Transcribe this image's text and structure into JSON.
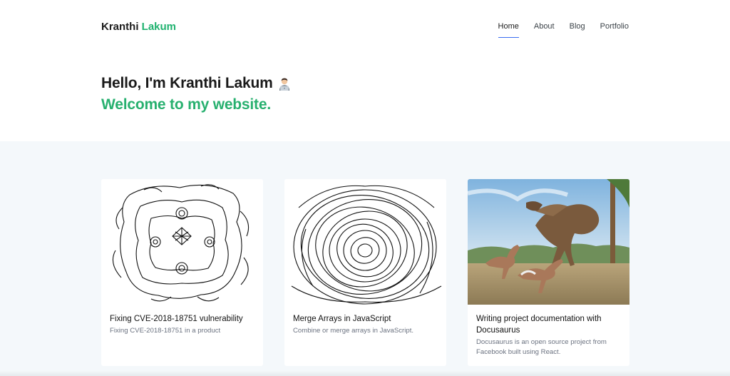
{
  "site": {
    "logo_first": "Kranthi",
    "logo_second": "Lakum"
  },
  "nav": {
    "items": [
      "Home",
      "About",
      "Blog",
      "Portfolio"
    ],
    "active": "Home"
  },
  "hero": {
    "line1": "Hello, I'm Kranthi Lakum",
    "line1_emoji": "technologist-icon",
    "line2": "Welcome to my website."
  },
  "cards": [
    {
      "title": "Fixing CVE-2018-18751 vulnerability",
      "desc": "Fixing CVE-2018-18751 in a product",
      "image": "abstract-line-art"
    },
    {
      "title": "Merge Arrays in JavaScript",
      "desc": "Combine or merge arrays in JavaScript.",
      "image": "scribble-spiral-art"
    },
    {
      "title": "Writing project documentation with Docusaurus",
      "desc": "Docusaurus is an open source project from Facebook built using React.",
      "image": "dinosaurs-illustration"
    }
  ],
  "colors": {
    "accent_green": "#27b06f",
    "nav_underline": "#3a6df0",
    "section_bg": "#f4f8fb"
  }
}
